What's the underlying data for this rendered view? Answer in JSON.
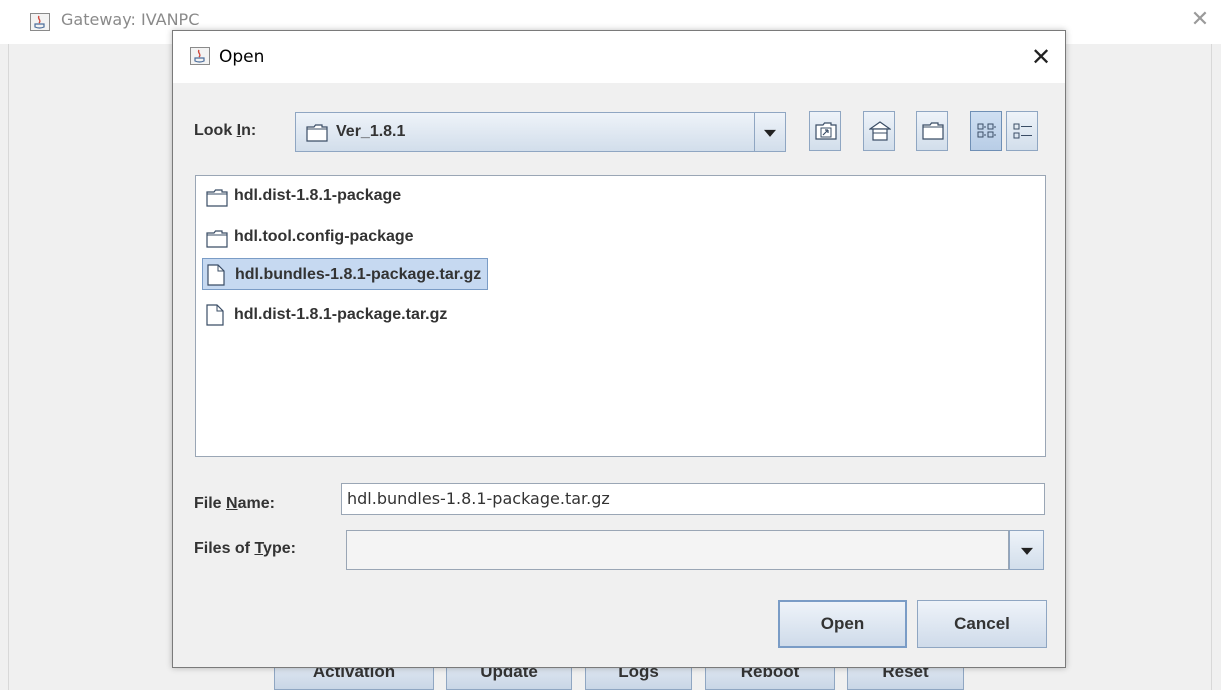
{
  "parent_window": {
    "title": "Gateway: IVANPC",
    "close_glyph": "✕",
    "bottom_buttons": [
      "Activation",
      "Update",
      "Logs",
      "Reboot",
      "Reset"
    ]
  },
  "dialog": {
    "title": "Open",
    "close_glyph": "✕",
    "look_in": {
      "label_prefix": "Look ",
      "label_mnemonic": "I",
      "label_suffix": "n:",
      "value": "Ver_1.8.1"
    },
    "toolbar": {
      "icons": [
        "up-one-level-icon",
        "home-icon",
        "new-folder-icon",
        "list-view-icon",
        "details-view-icon"
      ],
      "active": "list-view-icon"
    },
    "files": [
      {
        "name": "hdl.dist-1.8.1-package",
        "type": "folder",
        "selected": false
      },
      {
        "name": "hdl.tool.config-package",
        "type": "folder",
        "selected": false
      },
      {
        "name": "hdl.bundles-1.8.1-package.tar.gz",
        "type": "file",
        "selected": true
      },
      {
        "name": "hdl.dist-1.8.1-package.tar.gz",
        "type": "file",
        "selected": false
      }
    ],
    "file_name": {
      "label_prefix": "File ",
      "label_mnemonic": "N",
      "label_suffix": "ame:",
      "value": "hdl.bundles-1.8.1-package.tar.gz"
    },
    "files_of_type": {
      "label_prefix": "Files of ",
      "label_mnemonic": "T",
      "label_suffix": "ype:",
      "value": ""
    },
    "buttons": {
      "open": "Open",
      "cancel": "Cancel"
    }
  },
  "colors": {
    "selection_bg": "#c6d9f1",
    "selection_border": "#7a9cc6",
    "button_border": "#8fa6c2"
  }
}
